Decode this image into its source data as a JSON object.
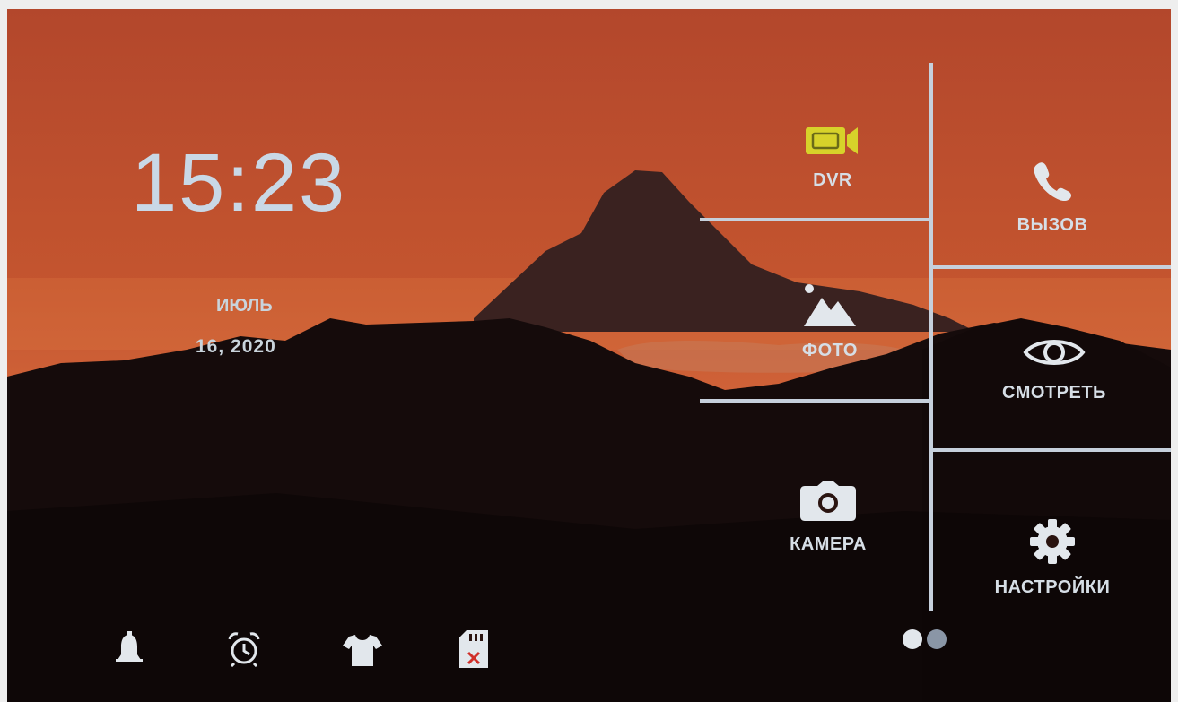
{
  "clock": {
    "time": "15:23"
  },
  "date": {
    "month": "ИЮЛЬ",
    "day_year": "16, 2020"
  },
  "menu": {
    "dvr": {
      "label": "DVR",
      "icon": "video-camera-icon",
      "color": "#d7d22a"
    },
    "call": {
      "label": "ВЫЗОВ",
      "icon": "phone-icon"
    },
    "photo": {
      "label": "ФОТО",
      "icon": "image-icon"
    },
    "monitor": {
      "label": "СМОТРЕТЬ",
      "icon": "eye-icon"
    },
    "camera": {
      "label": "КАМЕРА",
      "icon": "camera-icon"
    },
    "settings": {
      "label": "НАСТРОЙКИ",
      "icon": "gear-icon"
    }
  },
  "status_bar": [
    {
      "icon": "bell-icon"
    },
    {
      "icon": "alarm-clock-icon"
    },
    {
      "icon": "shirt-icon"
    },
    {
      "icon": "sd-card-error-icon"
    }
  ],
  "pager": {
    "pages": 2,
    "current": 1
  },
  "colors": {
    "line": "#c6d0dc",
    "text": "#d6dee6",
    "accent": "#d7d22a"
  }
}
